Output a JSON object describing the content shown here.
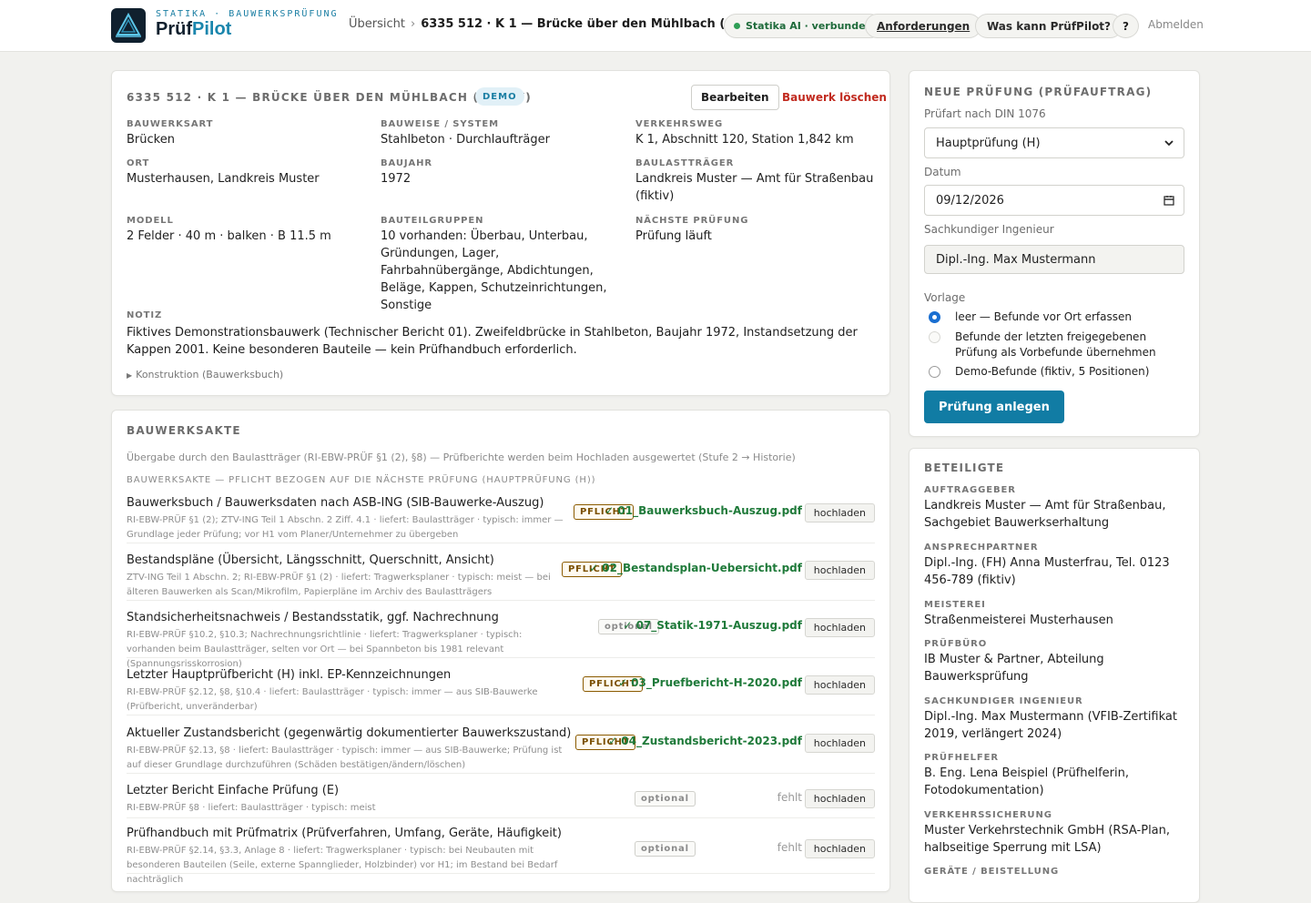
{
  "header": {
    "brand_top": "STATIKA · BAUWERKSPRÜFUNG",
    "brand_name_a": "Prüf",
    "brand_name_b": "Pilot",
    "breadcrumb_root": "Übersicht",
    "breadcrumb_sep": "›",
    "breadcrumb_current": "6335 512 · K 1 — Brücke über den Mühlbach (fiktiv)",
    "status": "Statika AI · verbunden",
    "requirements": "Anforderungen",
    "help": "Was kann PrüfPilot?",
    "question": "?",
    "logout": "Abmelden"
  },
  "structure": {
    "title": "6335 512 · K 1 — BRÜCKE ÜBER DEN MÜHLBACH (FIKTIV)",
    "badge": "DEMO",
    "edit": "Bearbeiten",
    "delete": "Bauwerk löschen",
    "fields": [
      {
        "label": "BAUWERKSART",
        "value": "Brücken"
      },
      {
        "label": "BAUWEISE / SYSTEM",
        "value": "Stahlbeton · Durchlaufträger"
      },
      {
        "label": "VERKEHRSWEG",
        "value": "K 1, Abschnitt 120, Station 1,842 km"
      },
      {
        "label": "ORT",
        "value": "Musterhausen, Landkreis Muster"
      },
      {
        "label": "BAUJAHR",
        "value": "1972"
      },
      {
        "label": "BAULASTTRÄGER",
        "value": "Landkreis Muster — Amt für Straßenbau (fiktiv)"
      },
      {
        "label": "MODELL",
        "value": "2 Felder · 40 m · balken · B 11.5 m"
      },
      {
        "label": "BAUTEILGRUPPEN",
        "value": "10 vorhanden: Überbau, Unterbau, Gründungen, Lager, Fahrbahnübergänge, Abdichtungen, Beläge, Kappen, Schutzeinrichtungen, Sonstige"
      },
      {
        "label": "NÄCHSTE PRÜFUNG",
        "value": "Prüfung läuft"
      }
    ],
    "note_label": "NOTIZ",
    "note": "Fiktives Demonstrationsbauwerk (Technischer Bericht 01). Zweifeldbrücke in Stahlbeton, Baujahr 1972, Instandsetzung der Kappen 2001. Keine besonderen Bauteile — kein Prüfhandbuch erforderlich.",
    "disclosure": "Konstruktion (Bauwerksbuch)"
  },
  "akte": {
    "title": "BAUWERKSAKTE",
    "subtitle": "Übergabe durch den Baulastträger (RI-EBW-PRÜF §1 (2), §8) — Prüfberichte werden beim Hochladen ausgewertet (Stufe 2 → Historie)",
    "subtitle2": "BAUWERKSAKTE — PFLICHT BEZOGEN AUF DIE NÄCHSTE PRÜFUNG (HAUPTPRÜFUNG (H))",
    "upload_label": "hochladen",
    "missing_label": "fehlt",
    "rows": [
      {
        "title": "Bauwerksbuch / Bauwerksdaten nach ASB-ING (SIB-Bauwerke-Auszug)",
        "meta": "RI-EBW-PRÜF §1 (2); ZTV-ING Teil 1 Abschn. 2 Ziff. 4.1 · liefert: Baulastträger · typisch: immer — Grundlage jeder Prüfung; vor H1 vom Planer/Unternehmer zu übergeben",
        "badge": "PFLICHT",
        "file": "✓ 01_Bauwerksbuch-Auszug.pdf"
      },
      {
        "title": "Bestandspläne (Übersicht, Längsschnitt, Querschnitt, Ansicht)",
        "meta": "ZTV-ING Teil 1 Abschn. 2; RI-EBW-PRÜF §1 (2) · liefert: Tragwerksplaner · typisch: meist — bei älteren Bauwerken als Scan/Mikrofilm, Papierpläne im Archiv des Baulastträgers",
        "badge": "PFLICHT",
        "file": "✓ 02_Bestandsplan-Uebersicht.pdf"
      },
      {
        "title": "Standsicherheitsnachweis / Bestandsstatik, ggf. Nachrechnung",
        "meta": "RI-EBW-PRÜF §10.2, §10.3; Nachrechnungsrichtlinie · liefert: Tragwerksplaner · typisch: vorhanden beim Baulastträger, selten vor Ort — bei Spannbeton bis 1981 relevant (Spannungsrisskorrosion)",
        "badge": "optional",
        "file": "✓ 07_Statik-1971-Auszug.pdf"
      },
      {
        "title": "Letzter Hauptprüfbericht (H) inkl. EP-Kennzeichnungen",
        "meta": "RI-EBW-PRÜF §2.12, §8, §10.4 · liefert: Baulastträger · typisch: immer — aus SIB-Bauwerke (Prüfbericht, unveränderbar)",
        "badge": "PFLICHT",
        "file": "✓ 03_Pruefbericht-H-2020.pdf"
      },
      {
        "title": "Aktueller Zustandsbericht (gegenwärtig dokumentierter Bauwerkszustand)",
        "meta": "RI-EBW-PRÜF §2.13, §8 · liefert: Baulastträger · typisch: immer — aus SIB-Bauwerke; Prüfung ist auf dieser Grundlage durchzuführen (Schäden bestätigen/ändern/löschen)",
        "badge": "PFLICHT",
        "file": "✓ 04_Zustandsbericht-2023.pdf"
      },
      {
        "title": "Letzter Bericht Einfache Prüfung (E)",
        "meta": "RI-EBW-PRÜF §8 · liefert: Baulastträger · typisch: meist",
        "badge": "optional",
        "file": ""
      },
      {
        "title": "Prüfhandbuch mit Prüfmatrix (Prüfverfahren, Umfang, Geräte, Häufigkeit)",
        "meta": "RI-EBW-PRÜF §2.14, §3.3, Anlage 8 · liefert: Tragwerksplaner · typisch: bei Neubauten mit besonderen Bauteilen (Seile, externe Spannglieder, Holzbinder) vor H1; im Bestand bei Bedarf nachträglich",
        "badge": "optional",
        "file": ""
      }
    ]
  },
  "new_inspection": {
    "title": "NEUE PRÜFUNG (PRÜFAUFTRAG)",
    "type_label": "Prüfart nach DIN 1076",
    "type_value": "Hauptprüfung (H)",
    "date_label": "Datum",
    "date_value": "09/12/2026",
    "engineer_label": "Sachkundiger Ingenieur",
    "engineer_value": "Dipl.-Ing. Max Mustermann",
    "template_label": "Vorlage",
    "options": [
      "leer — Befunde vor Ort erfassen",
      "Befunde der letzten freigegebenen Prüfung als Vorbefunde übernehmen",
      "Demo-Befunde (fiktiv, 5 Positionen)"
    ],
    "submit": "Prüfung anlegen"
  },
  "people": {
    "title": "BETEILIGTE",
    "items": [
      {
        "label": "AUFTRAGGEBER",
        "value": "Landkreis Muster — Amt für Straßenbau, Sachgebiet Bauwerkserhaltung"
      },
      {
        "label": "ANSPRECHPARTNER",
        "value": "Dipl.-Ing. (FH) Anna Musterfrau, Tel. 0123 456-789 (fiktiv)"
      },
      {
        "label": "MEISTEREI",
        "value": "Straßenmeisterei Musterhausen"
      },
      {
        "label": "PRÜFBÜRO",
        "value": "IB Muster & Partner, Abteilung Bauwerksprüfung"
      },
      {
        "label": "SACHKUNDIGER INGENIEUR",
        "value": "Dipl.-Ing. Max Mustermann (VFIB-Zertifikat 2019, verlängert 2024)"
      },
      {
        "label": "PRÜFHELFER",
        "value": "B. Eng. Lena Beispiel (Prüfhelferin, Fotodokumentation)"
      },
      {
        "label": "VERKEHRSSICHERUNG",
        "value": "Muster Verkehrstechnik GmbH (RSA-Plan, halbseitige Sperrung mit LSA)"
      },
      {
        "label": "GERÄTE / BEISTELLUNG",
        "value": ""
      }
    ]
  },
  "colors": {
    "accent": "#117ca4",
    "success": "#1f7a3a",
    "danger": "#c12a1f",
    "required": "#7a4f00"
  }
}
